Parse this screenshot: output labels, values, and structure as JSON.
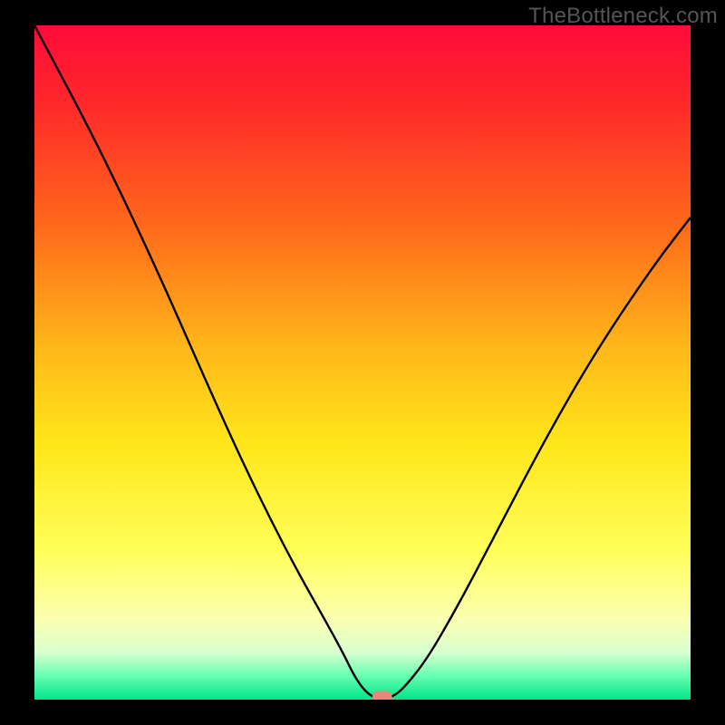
{
  "watermark": "TheBottleneck.com",
  "chart_data": {
    "type": "line",
    "title": "",
    "xlabel": "",
    "ylabel": "",
    "xlim": [
      0,
      100
    ],
    "ylim": [
      0,
      100
    ],
    "background_gradient": {
      "stops": [
        {
          "pos": 0.0,
          "color": "#ff0a3a"
        },
        {
          "pos": 0.12,
          "color": "#ff2a2a"
        },
        {
          "pos": 0.3,
          "color": "#ff6a1a"
        },
        {
          "pos": 0.48,
          "color": "#ffb81a"
        },
        {
          "pos": 0.62,
          "color": "#ffe61a"
        },
        {
          "pos": 0.78,
          "color": "#ffff5a"
        },
        {
          "pos": 0.88,
          "color": "#fbffb0"
        },
        {
          "pos": 0.93,
          "color": "#d8ffd0"
        },
        {
          "pos": 0.965,
          "color": "#66ffb0"
        },
        {
          "pos": 1.0,
          "color": "#00e58a"
        }
      ]
    },
    "series": [
      {
        "name": "bottleneck-curve",
        "color": "#000000",
        "x": [
          0,
          4,
          8,
          12,
          16,
          20,
          24,
          28,
          32,
          36,
          40,
          44,
          47,
          49,
          51,
          53,
          55,
          57,
          60,
          64,
          68,
          72,
          76,
          80,
          84,
          88,
          92,
          96,
          100
        ],
        "y": [
          100,
          92.7,
          85.3,
          77.5,
          69.3,
          60.8,
          52.0,
          43.2,
          34.7,
          26.7,
          19.2,
          12.3,
          7.0,
          3.0,
          0.6,
          0.0,
          0.6,
          2.5,
          6.3,
          13.0,
          20.3,
          27.8,
          35.2,
          42.3,
          49.0,
          55.2,
          61.0,
          66.5,
          71.5
        ]
      }
    ],
    "marker": {
      "name": "optimal-point",
      "x": 53,
      "y": 0.3,
      "width": 3.0,
      "height": 2.0,
      "color": "#e58a7a"
    }
  }
}
